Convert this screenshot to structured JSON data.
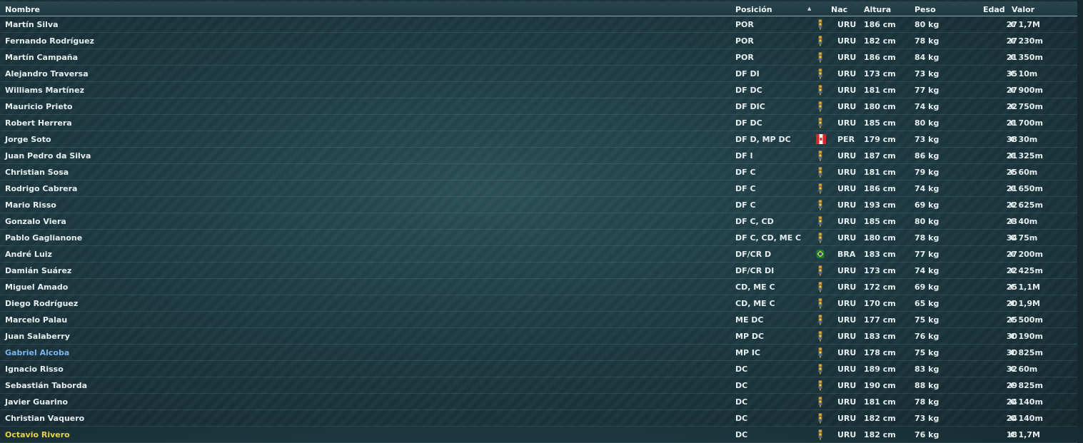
{
  "header": {
    "name": "Nombre",
    "position": "Posición",
    "sort_arrow": "▲",
    "nationality": "Nac",
    "height": "Altura",
    "weight": "Peso",
    "age": "Edad",
    "value": "Valor"
  },
  "flag_icons": {
    "URU": "uruguay-flag-icon",
    "PER": "peru-flag-icon",
    "BRA": "brazil-flag-icon"
  },
  "colors": {
    "highlight_blue": "#7ab4ee",
    "highlight_gold": "#e7d24a"
  },
  "players": [
    {
      "name": "Martín Silva",
      "position": "POR",
      "nat": "URU",
      "height": "186 cm",
      "weight": "80 kg",
      "age": "27",
      "value": "€ 1,7M"
    },
    {
      "name": "Fernando Rodríguez",
      "position": "POR",
      "nat": "URU",
      "height": "182 cm",
      "weight": "78 kg",
      "age": "27",
      "value": "€ 230m"
    },
    {
      "name": "Martín Campaña",
      "position": "POR",
      "nat": "URU",
      "height": "186 cm",
      "weight": "84 kg",
      "age": "21",
      "value": "€ 350m"
    },
    {
      "name": "Alejandro Traversa",
      "position": "DF DI",
      "nat": "URU",
      "height": "173 cm",
      "weight": "73 kg",
      "age": "35",
      "value": "€ 10m"
    },
    {
      "name": "Williams Martínez",
      "position": "DF DC",
      "nat": "URU",
      "height": "181 cm",
      "weight": "77 kg",
      "age": "27",
      "value": "€ 900m"
    },
    {
      "name": "Mauricio Prieto",
      "position": "DF DIC",
      "nat": "URU",
      "height": "180 cm",
      "weight": "74 kg",
      "age": "22",
      "value": "€ 750m"
    },
    {
      "name": "Robert Herrera",
      "position": "DF DC",
      "nat": "URU",
      "height": "185 cm",
      "weight": "80 kg",
      "age": "21",
      "value": "€ 700m"
    },
    {
      "name": "Jorge Soto",
      "position": "DF D, MP DC",
      "nat": "PER",
      "height": "179 cm",
      "weight": "73 kg",
      "age": "38",
      "value": "€ 30m"
    },
    {
      "name": "Juan Pedro da Silva",
      "position": "DF I",
      "nat": "URU",
      "height": "187 cm",
      "weight": "86 kg",
      "age": "21",
      "value": "€ 325m"
    },
    {
      "name": "Christian Sosa",
      "position": "DF C",
      "nat": "URU",
      "height": "181 cm",
      "weight": "79 kg",
      "age": "25",
      "value": "€ 60m"
    },
    {
      "name": "Rodrigo Cabrera",
      "position": "DF C",
      "nat": "URU",
      "height": "186 cm",
      "weight": "74 kg",
      "age": "21",
      "value": "€ 650m"
    },
    {
      "name": "Mario Risso",
      "position": "DF C",
      "nat": "URU",
      "height": "193 cm",
      "weight": "69 kg",
      "age": "22",
      "value": "€ 625m"
    },
    {
      "name": "Gonzalo Viera",
      "position": "DF C, CD",
      "nat": "URU",
      "height": "185 cm",
      "weight": "80 kg",
      "age": "23",
      "value": "€ 40m"
    },
    {
      "name": "Pablo Gaglianone",
      "position": "DF C, CD, ME C",
      "nat": "URU",
      "height": "180 cm",
      "weight": "78 kg",
      "age": "34",
      "value": "€ 75m"
    },
    {
      "name": "André Luiz",
      "position": "DF/CR D",
      "nat": "BRA",
      "height": "183 cm",
      "weight": "77 kg",
      "age": "27",
      "value": "€ 200m"
    },
    {
      "name": "Damián Suárez",
      "position": "DF/CR DI",
      "nat": "URU",
      "height": "173 cm",
      "weight": "74 kg",
      "age": "22",
      "value": "€ 425m"
    },
    {
      "name": "Miguel Amado",
      "position": "CD, ME C",
      "nat": "URU",
      "height": "172 cm",
      "weight": "69 kg",
      "age": "25",
      "value": "€ 1,1M"
    },
    {
      "name": "Diego Rodríguez",
      "position": "CD, ME C",
      "nat": "URU",
      "height": "170 cm",
      "weight": "65 kg",
      "age": "20",
      "value": "€ 1,9M"
    },
    {
      "name": "Marcelo Palau",
      "position": "ME DC",
      "nat": "URU",
      "height": "177 cm",
      "weight": "75 kg",
      "age": "25",
      "value": "€ 500m"
    },
    {
      "name": "Juan Salaberry",
      "position": "MP DC",
      "nat": "URU",
      "height": "183 cm",
      "weight": "76 kg",
      "age": "30",
      "value": "€ 190m"
    },
    {
      "name": "Gabriel Alcoba",
      "position": "MP IC",
      "nat": "URU",
      "height": "178 cm",
      "weight": "75 kg",
      "age": "30",
      "value": "€ 825m",
      "highlight": "blue"
    },
    {
      "name": "Ignacio Risso",
      "position": "DC",
      "nat": "URU",
      "height": "189 cm",
      "weight": "83 kg",
      "age": "32",
      "value": "€ 60m"
    },
    {
      "name": "Sebastián Taborda",
      "position": "DC",
      "nat": "URU",
      "height": "190 cm",
      "weight": "88 kg",
      "age": "29",
      "value": "€ 825m"
    },
    {
      "name": "Javier Guarino",
      "position": "DC",
      "nat": "URU",
      "height": "181 cm",
      "weight": "78 kg",
      "age": "24",
      "value": "€ 140m"
    },
    {
      "name": "Christian Vaquero",
      "position": "DC",
      "nat": "URU",
      "height": "182 cm",
      "weight": "73 kg",
      "age": "24",
      "value": "€ 140m"
    },
    {
      "name": "Octavio Rivero",
      "position": "DC",
      "nat": "URU",
      "height": "182 cm",
      "weight": "76 kg",
      "age": "18",
      "value": "€ 1,7M",
      "highlight": "gold"
    }
  ]
}
